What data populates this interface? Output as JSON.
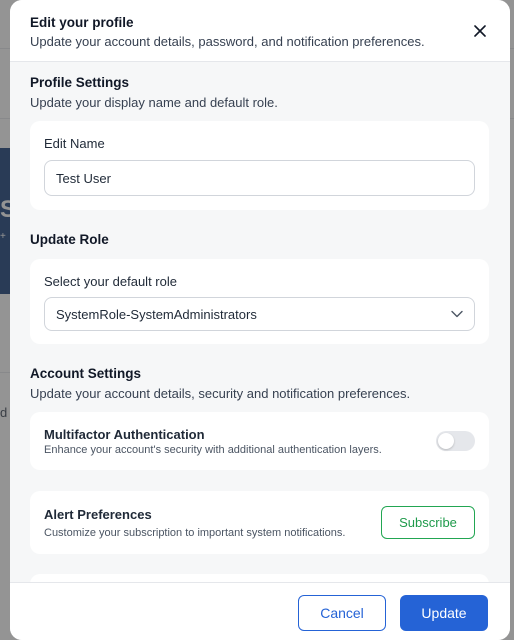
{
  "background": {
    "banner_glyph": "S",
    "banner_glyph2": "+",
    "side_letter": "d"
  },
  "modal": {
    "title": "Edit your profile",
    "subtitle": "Update your account details, password, and notification preferences.",
    "close_icon": "close-icon"
  },
  "profile_settings": {
    "heading": "Profile Settings",
    "subtitle": "Update your display name and default role.",
    "edit_name_label": "Edit Name",
    "name_value": "Test User"
  },
  "update_role": {
    "heading": "Update Role",
    "select_label": "Select your default role",
    "selected_role": "SystemRole-SystemAdministrators",
    "dropdown_icon": "chevron-down-icon"
  },
  "account_settings": {
    "heading": "Account Settings",
    "subtitle": "Update your account details, security and notification preferences.",
    "mfa": {
      "title": "Multifactor Authentication",
      "description": "Enhance your account's security with additional authentication layers.",
      "enabled": false
    },
    "alerts": {
      "title": "Alert Preferences",
      "description": "Customize your subscription to important system notifications.",
      "button_label": "Subscribe"
    }
  },
  "footer": {
    "cancel_label": "Cancel",
    "update_label": "Update"
  },
  "colors": {
    "primary": "#2563d6",
    "success": "#22a652",
    "banner": "#123a75"
  }
}
